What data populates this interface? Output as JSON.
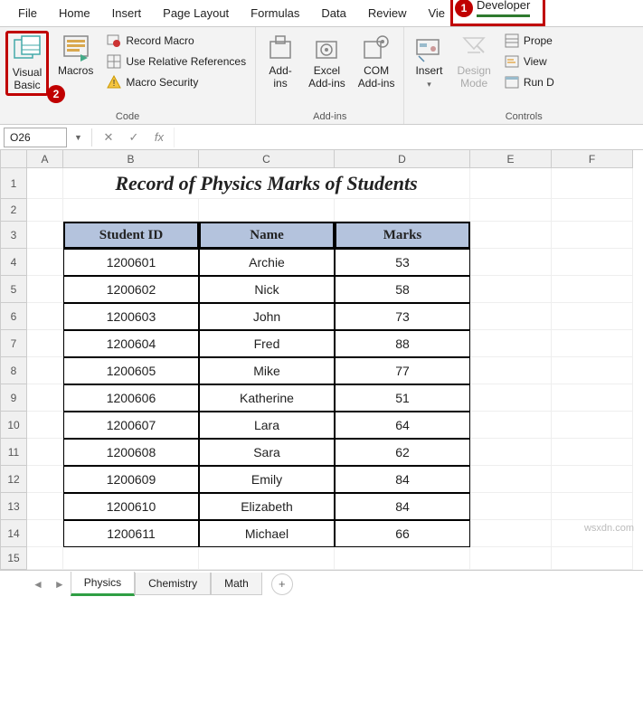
{
  "ribbon_tabs": [
    "File",
    "Home",
    "Insert",
    "Page Layout",
    "Formulas",
    "Data",
    "Review",
    "Vie",
    "Developer"
  ],
  "step1": "1",
  "step2": "2",
  "ribbon": {
    "visual_basic": "Visual\nBasic",
    "macros": "Macros",
    "record_macro": "Record Macro",
    "relative_refs": "Use Relative References",
    "macro_security": "Macro Security",
    "code_group": "Code",
    "addins": "Add-\nins",
    "excel_addins": "Excel\nAdd-ins",
    "com_addins": "COM\nAdd-ins",
    "addins_group": "Add-ins",
    "insert": "Insert",
    "design_mode": "Design\nMode",
    "properties": "Prope",
    "view_code": "View",
    "run_dialog": "Run D",
    "controls_group": "Controls"
  },
  "name_box": "O26",
  "fx_label": "fx",
  "columns": [
    "A",
    "B",
    "C",
    "D",
    "E",
    "F"
  ],
  "title": "Record of Physics Marks of Students",
  "headers": [
    "Student ID",
    "Name",
    "Marks"
  ],
  "chart_data": {
    "type": "table",
    "columns": [
      "Student ID",
      "Name",
      "Marks"
    ],
    "rows": [
      [
        "1200601",
        "Archie",
        "53"
      ],
      [
        "1200602",
        "Nick",
        "58"
      ],
      [
        "1200603",
        "John",
        "73"
      ],
      [
        "1200604",
        "Fred",
        "88"
      ],
      [
        "1200605",
        "Mike",
        "77"
      ],
      [
        "1200606",
        "Katherine",
        "51"
      ],
      [
        "1200607",
        "Lara",
        "64"
      ],
      [
        "1200608",
        "Sara",
        "62"
      ],
      [
        "1200609",
        "Emily",
        "84"
      ],
      [
        "1200610",
        "Elizabeth",
        "84"
      ],
      [
        "1200611",
        "Michael",
        "66"
      ]
    ]
  },
  "row_nums": [
    "1",
    "2",
    "3",
    "4",
    "5",
    "6",
    "7",
    "8",
    "9",
    "10",
    "11",
    "12",
    "13",
    "14",
    "15"
  ],
  "sheets": [
    "Physics",
    "Chemistry",
    "Math"
  ],
  "watermark": "wsxdn.com"
}
